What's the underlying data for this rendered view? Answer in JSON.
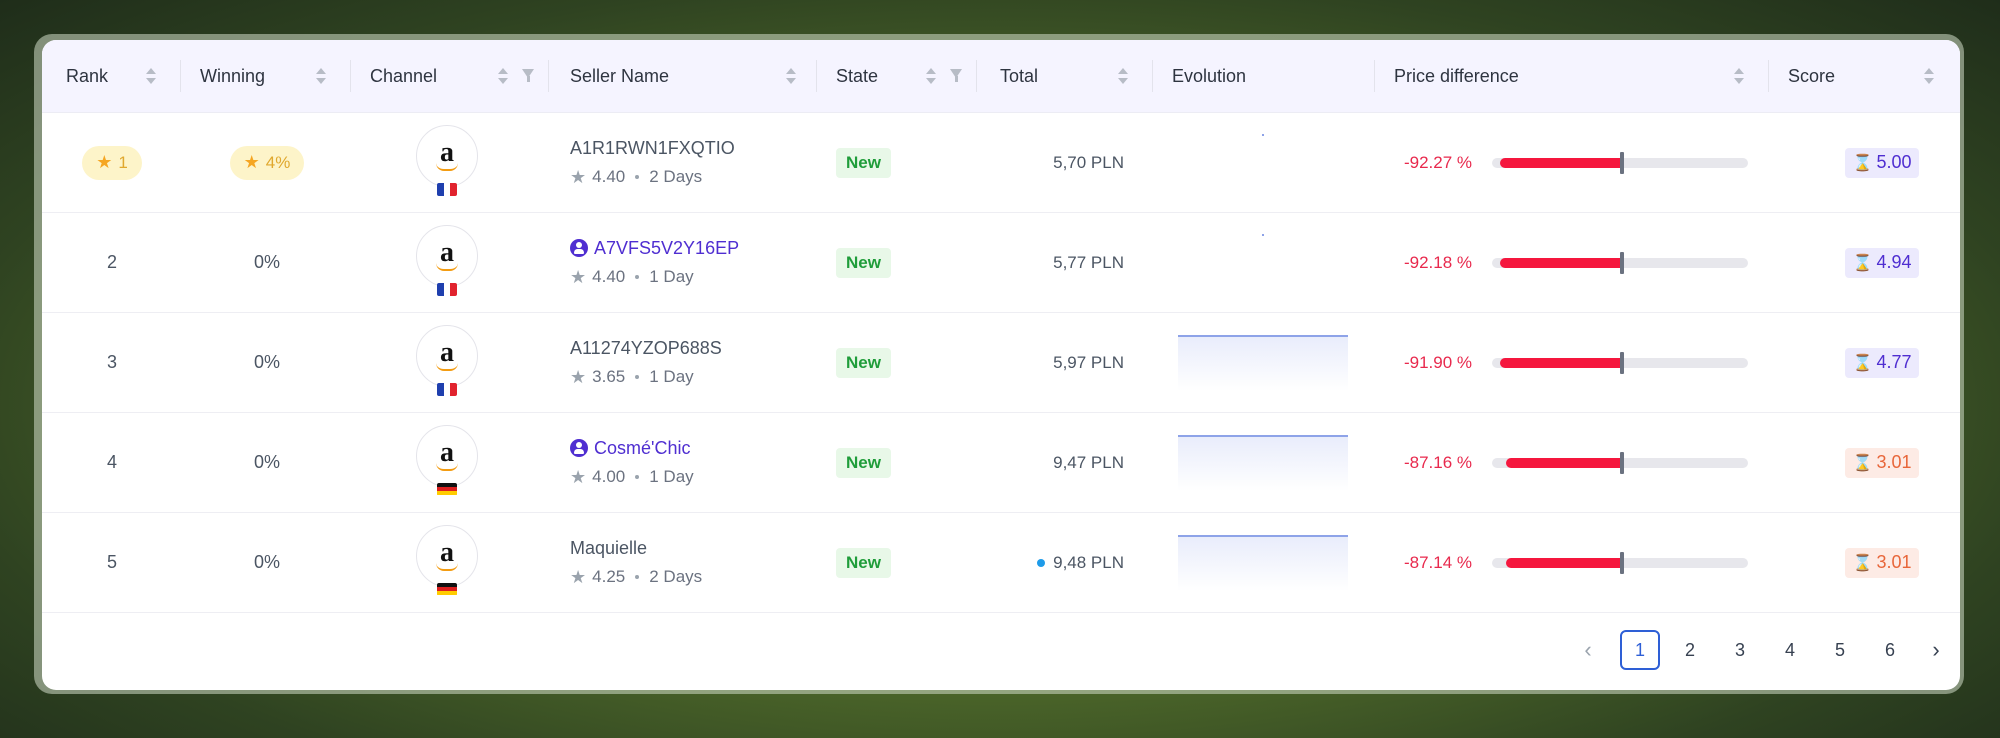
{
  "header": {
    "rank": "Rank",
    "winning": "Winning",
    "channel": "Channel",
    "seller_name": "Seller Name",
    "state": "State",
    "total": "Total",
    "evolution": "Evolution",
    "price_difference": "Price difference",
    "score": "Score"
  },
  "rows": [
    {
      "rank": "1",
      "winning": "4%",
      "top": true,
      "flag": "fr",
      "seller": "A1R1RWN1FXQTIO",
      "linked": false,
      "rating": "4.40",
      "age": "2 Days",
      "state": "New",
      "total": "5,70 PLN",
      "indicator": false,
      "evolution": "dot",
      "pct": "-92.27 %",
      "fill": 0.92,
      "score": "5.00",
      "score_level": "good"
    },
    {
      "rank": "2",
      "winning": "0%",
      "top": false,
      "flag": "fr",
      "seller": "A7VFS5V2Y16EP",
      "linked": true,
      "rating": "4.40",
      "age": "1 Day",
      "state": "New",
      "total": "5,77 PLN",
      "indicator": false,
      "evolution": "dot",
      "pct": "-92.18 %",
      "fill": 0.92,
      "score": "4.94",
      "score_level": "good"
    },
    {
      "rank": "3",
      "winning": "0%",
      "top": false,
      "flag": "fr",
      "seller": "A11274YZOP688S",
      "linked": false,
      "rating": "3.65",
      "age": "1 Day",
      "state": "New",
      "total": "5,97 PLN",
      "indicator": false,
      "evolution": "line",
      "pct": "-91.90 %",
      "fill": 0.92,
      "score": "4.77",
      "score_level": "good"
    },
    {
      "rank": "4",
      "winning": "0%",
      "top": false,
      "flag": "de",
      "seller": "Cosmé'Chic",
      "linked": true,
      "rating": "4.00",
      "age": "1 Day",
      "state": "New",
      "total": "9,47 PLN",
      "indicator": false,
      "evolution": "line",
      "pct": "-87.16 %",
      "fill": 0.87,
      "score": "3.01",
      "score_level": "bad"
    },
    {
      "rank": "5",
      "winning": "0%",
      "top": false,
      "flag": "de",
      "seller": "Maquielle",
      "linked": false,
      "rating": "4.25",
      "age": "2 Days",
      "state": "New",
      "total": "9,48 PLN",
      "indicator": true,
      "evolution": "line",
      "pct": "-87.14 %",
      "fill": 0.87,
      "score": "3.01",
      "score_level": "bad"
    }
  ],
  "pagination": {
    "prev": "‹",
    "next": "›",
    "pages": [
      "1",
      "2",
      "3",
      "4",
      "5",
      "6"
    ],
    "current": "1"
  },
  "colors": {
    "accent": "#4f2ed1",
    "negative": "#e8294d",
    "bar_fill": "#f5173e",
    "state_green": "#1f9d3a",
    "score_good": "#4f2ed1",
    "score_bad": "#e8663a"
  },
  "icons": {
    "sort": "sort-icon",
    "filter": "filter-icon",
    "star": "star-icon",
    "user": "user-icon",
    "hourglass": "hourglass-icon"
  }
}
